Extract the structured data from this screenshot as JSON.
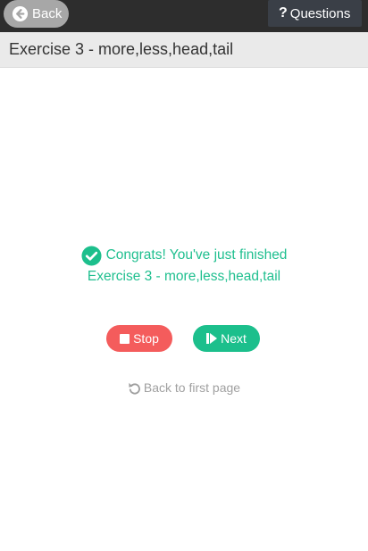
{
  "topbar": {
    "back_label": "Back",
    "back_icon": "arrow-circle-left-icon",
    "questions_label": "Questions",
    "questions_icon": "question-mark-icon"
  },
  "header": {
    "title": "Exercise 3 - more,less,head,tail"
  },
  "result": {
    "icon": "check-circle-icon",
    "line1": "Congrats! You've just finished",
    "line2": "Exercise 3 - more,less,head,tail"
  },
  "actions": {
    "stop_label": "Stop",
    "stop_icon": "stop-square-icon",
    "next_label": "Next",
    "next_icon": "step-forward-icon"
  },
  "footer": {
    "back_first_label": "Back to first page",
    "back_first_icon": "undo-icon"
  },
  "colors": {
    "topbar": "#2d2d2d",
    "accent_green": "#1cbf8c",
    "stop_red": "#f45c5c",
    "muted_gray": "#a0a0a0"
  }
}
